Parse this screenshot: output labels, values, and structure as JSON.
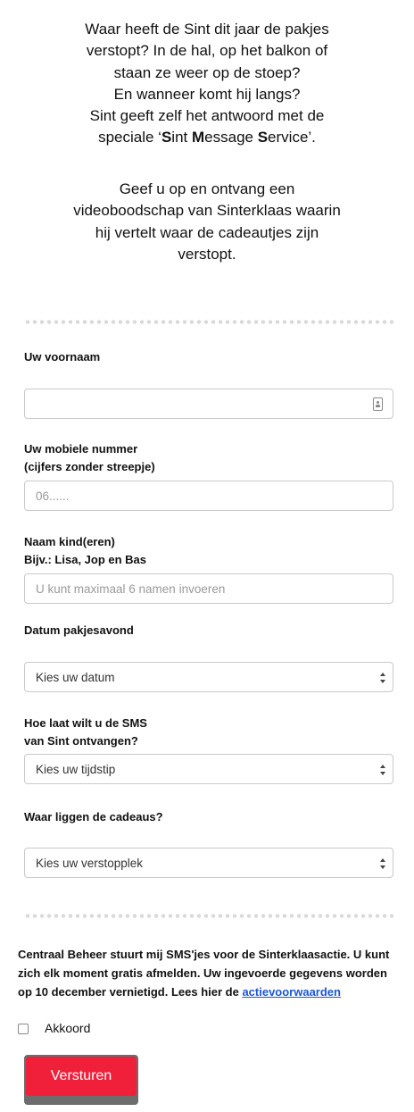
{
  "intro": {
    "lines1": [
      "Waar heeft de Sint dit jaar de pakjes",
      "verstopt? In de hal, op het balkon of",
      "staan ze weer op de stoep?",
      "En wanneer komt hij langs?",
      "Sint geeft zelf het antwoord met de"
    ],
    "service_prefix": "speciale ‘",
    "service_s": "S",
    "service_int": "int ",
    "service_m": "M",
    "service_essage": "essage ",
    "service_s2": "S",
    "service_ervice": "ervice’.",
    "lines2": [
      "Geef u op en ontvang een",
      "videoboodschap van Sinterklaas waarin",
      "hij vertelt waar de cadeautjes zijn",
      "verstopt."
    ]
  },
  "form": {
    "firstname_label": "Uw voornaam",
    "mobile_label_1": "Uw mobiele nummer",
    "mobile_label_2": "(cijfers zonder streepje)",
    "mobile_placeholder": "06......",
    "kids_label_1": "Naam kind(eren)",
    "kids_label_2": "Bijv.: Lisa, Jop en Bas",
    "kids_placeholder": "U kunt maximaal 6 namen invoeren",
    "date_label": "Datum pakjesavond",
    "date_value": "Kies uw datum",
    "time_label_1": "Hoe laat wilt u de SMS",
    "time_label_2": "van Sint ontvangen?",
    "time_value": "Kies uw tijdstip",
    "place_label": "Waar liggen de cadeaus?",
    "place_value": "Kies uw verstopplek"
  },
  "legal": {
    "text": "Centraal Beheer stuurt mij SMS'jes voor de Sinterklaasactie. U kunt zich elk moment gratis afmelden. Uw ingevoerde gegevens worden op 10 december vernietigd. Lees hier de ",
    "link": "actievoorwaarden"
  },
  "consent_label": "Akkoord",
  "submit_label": "Versturen",
  "colors": {
    "button": "#f0203a",
    "link": "#1a56d6"
  }
}
